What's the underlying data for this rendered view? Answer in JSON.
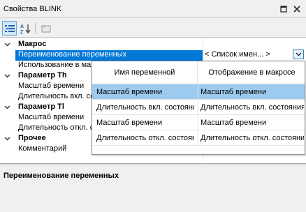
{
  "window": {
    "title": "Свойства BLINK"
  },
  "grid": {
    "rows": [
      {
        "kind": "cat",
        "label": "Макрос"
      },
      {
        "kind": "prop",
        "label": "Переименование переменных",
        "value": "< Список имен... >",
        "selected": true
      },
      {
        "kind": "prop",
        "label": "Использование в макросе",
        "value": ""
      },
      {
        "kind": "cat",
        "label": "Параметр Th"
      },
      {
        "kind": "prop",
        "label": "Масштаб времени",
        "value": ""
      },
      {
        "kind": "prop",
        "label": "Длительность вкл. состояния",
        "value": ""
      },
      {
        "kind": "cat",
        "label": "Параметр Tl"
      },
      {
        "kind": "prop",
        "label": "Масштаб времени",
        "value": ""
      },
      {
        "kind": "prop",
        "label": "Длительность откл. состояния",
        "value": ""
      },
      {
        "kind": "cat",
        "label": "Прочее"
      },
      {
        "kind": "prop",
        "label": "Комментарий",
        "value": ""
      }
    ]
  },
  "popup": {
    "col1_header": "Имя переменной",
    "col2_header": "Отображение в макросе",
    "rows": [
      {
        "name": "Масштаб времени",
        "display": "Масштаб времени",
        "selected": true
      },
      {
        "name": "Длительность вкл. состояния",
        "display": "Длительность вкл. состояния",
        "selected": false
      },
      {
        "name": "Масштаб времени",
        "display": "Масштаб времени",
        "selected": false
      },
      {
        "name": "Длительность откл. состояния",
        "display": "Длительность откл. состояния",
        "selected": false
      }
    ]
  },
  "description": {
    "title": "Переименование переменных"
  }
}
